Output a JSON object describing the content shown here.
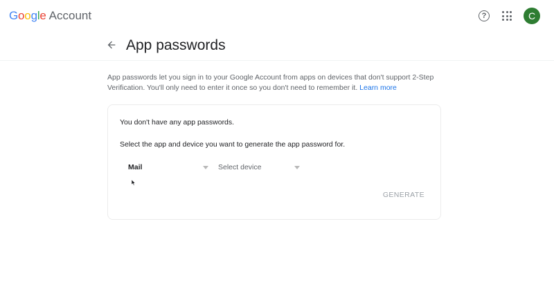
{
  "header": {
    "logo_letters": [
      "G",
      "o",
      "o",
      "g",
      "l",
      "e"
    ],
    "logo_colors": [
      "#4285F4",
      "#EA4335",
      "#FBBC05",
      "#4285F4",
      "#34A853",
      "#EA4335"
    ],
    "product_name": "Account",
    "help_icon": "?",
    "avatar_letter": "C",
    "avatar_color": "#2e7d32"
  },
  "page": {
    "title": "App passwords",
    "description": "App passwords let you sign in to your Google Account from apps on devices that don't support 2-Step Verification. You'll only need to enter it once so you don't need to remember it.",
    "learn_more": "Learn more"
  },
  "card": {
    "empty_message": "You don't have any app passwords.",
    "instruction": "Select the app and device you want to generate the app password for.",
    "app_select_value": "Mail",
    "device_select_placeholder": "Select device",
    "generate_label": "GENERATE"
  },
  "colors": {
    "link": "#1a73e8",
    "disabled_text": "#9aa0a6"
  }
}
